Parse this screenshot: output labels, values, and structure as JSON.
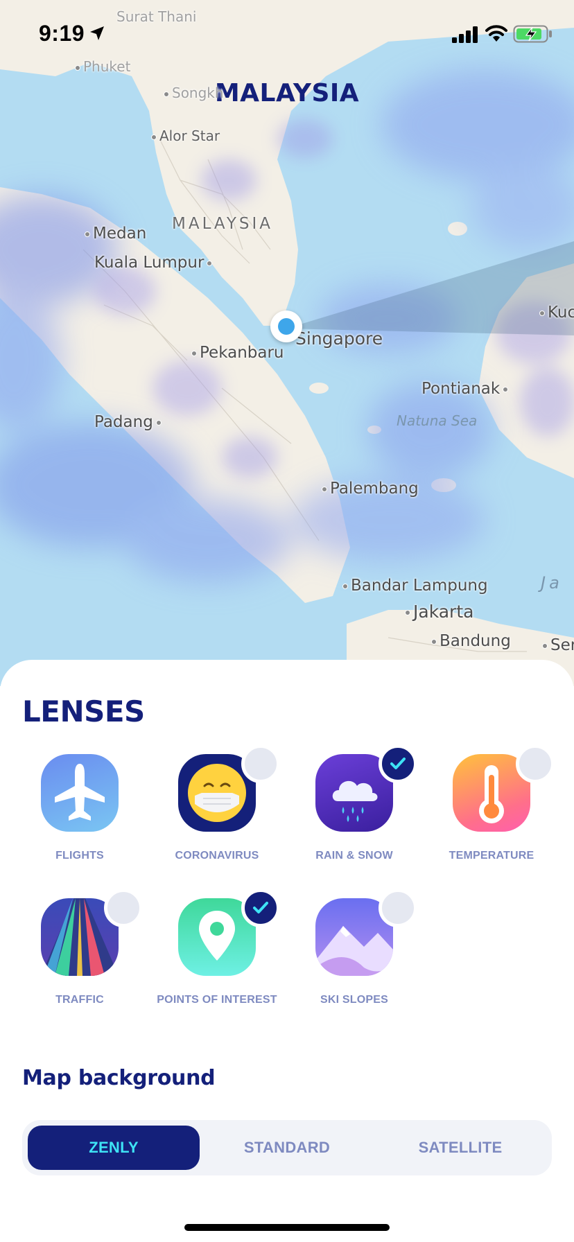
{
  "status_bar": {
    "time": "9:19"
  },
  "map": {
    "title": "MALAYSIA",
    "places": {
      "surat_thani": "Surat Thani",
      "phuket": "Phuket",
      "songkhla": "Songkh",
      "alor_star": "Alor Star",
      "malaysia": "MALAYSIA",
      "medan": "Medan",
      "kuala_lumpur": "Kuala Lumpur",
      "singapore": "Singapore",
      "pekanbaru": "Pekanbaru",
      "kuching": "Kuc",
      "pontianak": "Pontianak",
      "natuna_sea": "Natuna Sea",
      "padang": "Padang",
      "palembang": "Palembang",
      "bandar_lampung": "Bandar Lampung",
      "jakarta": "Jakarta",
      "bandung": "Bandung",
      "java_sea": "Ja",
      "semarang": "Ser"
    }
  },
  "lenses": {
    "title": "LENSES",
    "items": [
      {
        "label": "FLIGHTS",
        "icon": "airplane-icon",
        "state": "none"
      },
      {
        "label": "CORONAVIRUS",
        "icon": "face-mask-icon",
        "state": "off"
      },
      {
        "label": "RAIN & SNOW",
        "icon": "rain-cloud-icon",
        "state": "on"
      },
      {
        "label": "TEMPERATURE",
        "icon": "thermometer-icon",
        "state": "off"
      },
      {
        "label": "TRAFFIC",
        "icon": "road-icon",
        "state": "off"
      },
      {
        "label": "POINTS OF INTEREST",
        "icon": "map-pin-icon",
        "state": "on"
      },
      {
        "label": "SKI SLOPES",
        "icon": "mountain-icon",
        "state": "off"
      }
    ]
  },
  "map_background": {
    "title": "Map background",
    "options": [
      "ZENLY",
      "STANDARD",
      "SATELLITE"
    ],
    "selected": "ZENLY"
  },
  "colors": {
    "navy": "#14207a",
    "label_gray": "#7e8ac0",
    "active_text": "#3ee3f5",
    "location_blue": "#3ea6ea"
  }
}
